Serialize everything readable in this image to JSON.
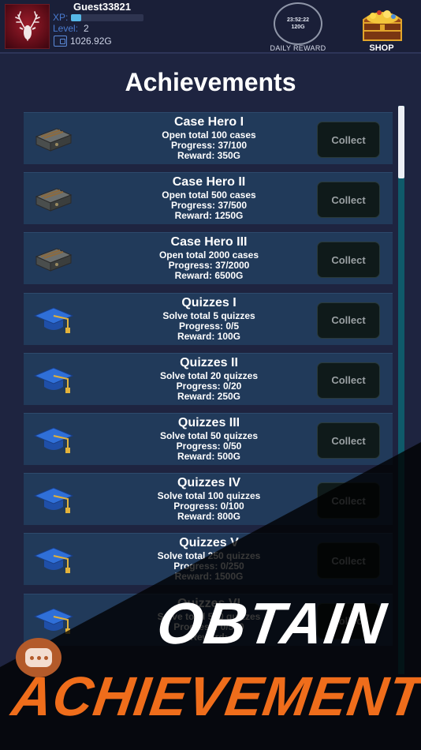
{
  "header": {
    "username": "Guest33821",
    "xp_label": "XP:",
    "xp_progress": 0.14,
    "level_label": "Level:",
    "level_value": "2",
    "gold": "1026.92G",
    "daily_timer": "23:52:22",
    "daily_amount": "120G",
    "daily_label": "DAILY REWARD",
    "shop_label": "SHOP"
  },
  "page_title": "Achievements",
  "achievements": [
    {
      "title": "Case Hero I",
      "task": "Open total 100 cases",
      "progress": "Progress: 37/100",
      "reward": "Reward: 350G",
      "icon": "case-icon",
      "button": "Collect"
    },
    {
      "title": "Case Hero II",
      "task": "Open total 500 cases",
      "progress": "Progress: 37/500",
      "reward": "Reward: 1250G",
      "icon": "case-icon",
      "button": "Collect"
    },
    {
      "title": "Case Hero III",
      "task": "Open total 2000 cases",
      "progress": "Progress: 37/2000",
      "reward": "Reward: 6500G",
      "icon": "case-icon",
      "button": "Collect"
    },
    {
      "title": "Quizzes I",
      "task": "Solve total 5 quizzes",
      "progress": "Progress: 0/5",
      "reward": "Reward: 100G",
      "icon": "graduation-cap-icon",
      "button": "Collect"
    },
    {
      "title": "Quizzes II",
      "task": "Solve total 20 quizzes",
      "progress": "Progress: 0/20",
      "reward": "Reward: 250G",
      "icon": "graduation-cap-icon",
      "button": "Collect"
    },
    {
      "title": "Quizzes III",
      "task": "Solve total 50 quizzes",
      "progress": "Progress: 0/50",
      "reward": "Reward: 500G",
      "icon": "graduation-cap-icon",
      "button": "Collect"
    },
    {
      "title": "Quizzes IV",
      "task": "Solve total 100 quizzes",
      "progress": "Progress: 0/100",
      "reward": "Reward: 800G",
      "icon": "graduation-cap-icon",
      "button": "Collect"
    },
    {
      "title": "Quizzes V",
      "task": "Solve total 250 quizzes",
      "progress": "Progress: 0/250",
      "reward": "Reward: 1500G",
      "icon": "graduation-cap-icon",
      "button": "Collect"
    },
    {
      "title": "Quizzes VI",
      "task": "Solve total 500 quizzes",
      "progress": "Progress: 0/500",
      "reward": "Reward:",
      "icon": "graduation-cap-icon",
      "button": "Collect"
    }
  ],
  "banner": {
    "line1": "OBTAIN",
    "line2": "ACHIEVEMENTS"
  },
  "colors": {
    "background": "#1e2440",
    "card": "#213a5a",
    "accent_orange": "#ef6d1b",
    "xp_fill": "#56b7e6"
  }
}
